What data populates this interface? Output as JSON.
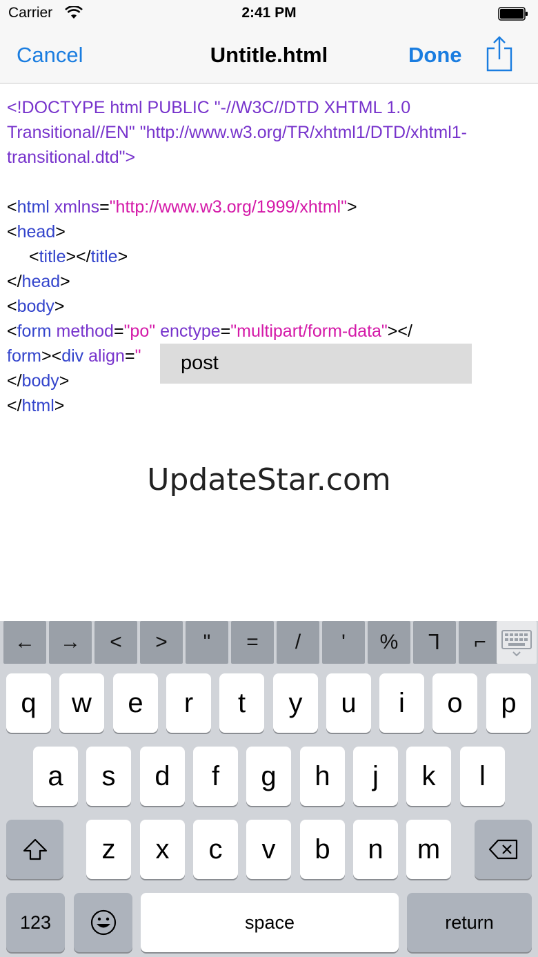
{
  "status": {
    "carrier": "Carrier",
    "time": "2:41 PM"
  },
  "nav": {
    "cancel": "Cancel",
    "title": "Untitle.html",
    "done": "Done"
  },
  "editor": {
    "doctype_l1": "<!DOCTYPE html PUBLIC \"-//W3C//DTD XHTML 1.0",
    "doctype_l2": "Transitional//EN\" \"http://www.w3.org/TR/xhtml1/DTD/xhtml1-",
    "doctype_l3": "transitional.dtd\">",
    "lt": "<",
    "gt": ">",
    "lts": "</",
    "eq": "=",
    "html_tag": "html",
    "xmlns_attr": " xmlns",
    "xmlns_val": "\"http://www.w3.org/1999/xhtml\"",
    "head_tag": "head",
    "title_tag": "title",
    "body_tag": "body",
    "form_tag": "form",
    "method_attr": " method",
    "method_val": "\"po\"",
    "enctype_attr": " enctype",
    "enctype_val": "\"multipart/form-data\"",
    "form_close_tag": "form",
    "div_tag": "div",
    "align_attr": " align",
    "align_val_start": "\""
  },
  "autocomplete": {
    "items": [
      "post"
    ]
  },
  "watermark": "UpdateStar.com",
  "accessory_keys": [
    "←",
    "→",
    "<",
    ">",
    "\"",
    "=",
    "/",
    "'",
    "%",
    "⅂",
    "⌐"
  ],
  "keyboard": {
    "row1": [
      "q",
      "w",
      "e",
      "r",
      "t",
      "y",
      "u",
      "i",
      "o",
      "p"
    ],
    "row2": [
      "a",
      "s",
      "d",
      "f",
      "g",
      "h",
      "j",
      "k",
      "l"
    ],
    "row3": [
      "z",
      "x",
      "c",
      "v",
      "b",
      "n",
      "m"
    ],
    "numbers": "123",
    "space": "space",
    "return": "return"
  },
  "colors": {
    "accent": "#1a7de0",
    "tag": "#3344cc",
    "attr": "#7733cc",
    "string": "#d419a8"
  }
}
